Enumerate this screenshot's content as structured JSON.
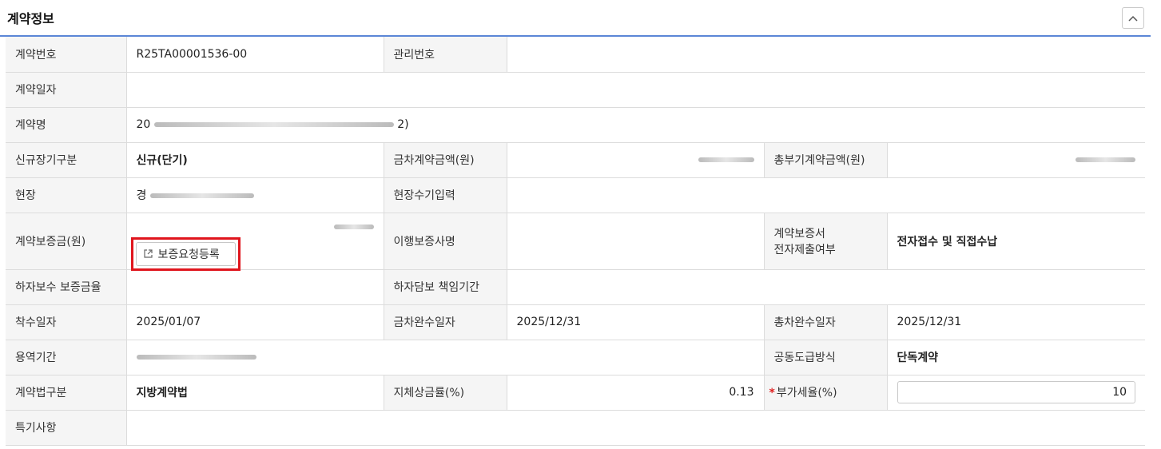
{
  "panel": {
    "title": "계약정보"
  },
  "rows": {
    "contract_no": {
      "label": "계약번호",
      "value": "R25TA00001536-00"
    },
    "manage_no": {
      "label": "관리번호",
      "value": ""
    },
    "contract_date": {
      "label": "계약일자",
      "value": ""
    },
    "contract_name": {
      "label": "계약명",
      "value_start": "20",
      "value_end": "2)"
    },
    "new_long": {
      "label": "신규장기구분",
      "value": "신규(단기)"
    },
    "this_amount": {
      "label": "금차계약금액(원)"
    },
    "total_amount": {
      "label": "총부기계약금액(원)"
    },
    "site": {
      "label": "현장",
      "value_start": "경"
    },
    "site_manual": {
      "label": "현장수기입력",
      "value": ""
    },
    "deposit": {
      "label": "계약보증금(원)",
      "button_label": "보증요청등록"
    },
    "performance_guarantor": {
      "label": "이행보증사명",
      "value": ""
    },
    "electronic_submit": {
      "label_line1": "계약보증서",
      "label_line2": "전자제출여부",
      "value": "전자접수 및 직접수납"
    },
    "defect_amount": {
      "label": "하자보수 보증금율",
      "value": ""
    },
    "defect_period": {
      "label": "하자담보 책임기간",
      "value": ""
    },
    "start_date": {
      "label": "착수일자",
      "value": "2025/01/07"
    },
    "this_completion": {
      "label": "금차완수일자",
      "value": "2025/12/31"
    },
    "total_completion": {
      "label": "총차완수일자",
      "value": "2025/12/31"
    },
    "service_period": {
      "label": "용역기간"
    },
    "joint_method": {
      "label": "공동도급방식",
      "value": "단독계약"
    },
    "contract_law": {
      "label": "계약법구분",
      "value": "지방계약법"
    },
    "delay_rate": {
      "label": "지체상금률(%)",
      "value": "0.13"
    },
    "vat_rate": {
      "required_mark": "*",
      "label": "부가세율(%)",
      "value": "10"
    },
    "special": {
      "label": "특기사항",
      "value": ""
    }
  }
}
